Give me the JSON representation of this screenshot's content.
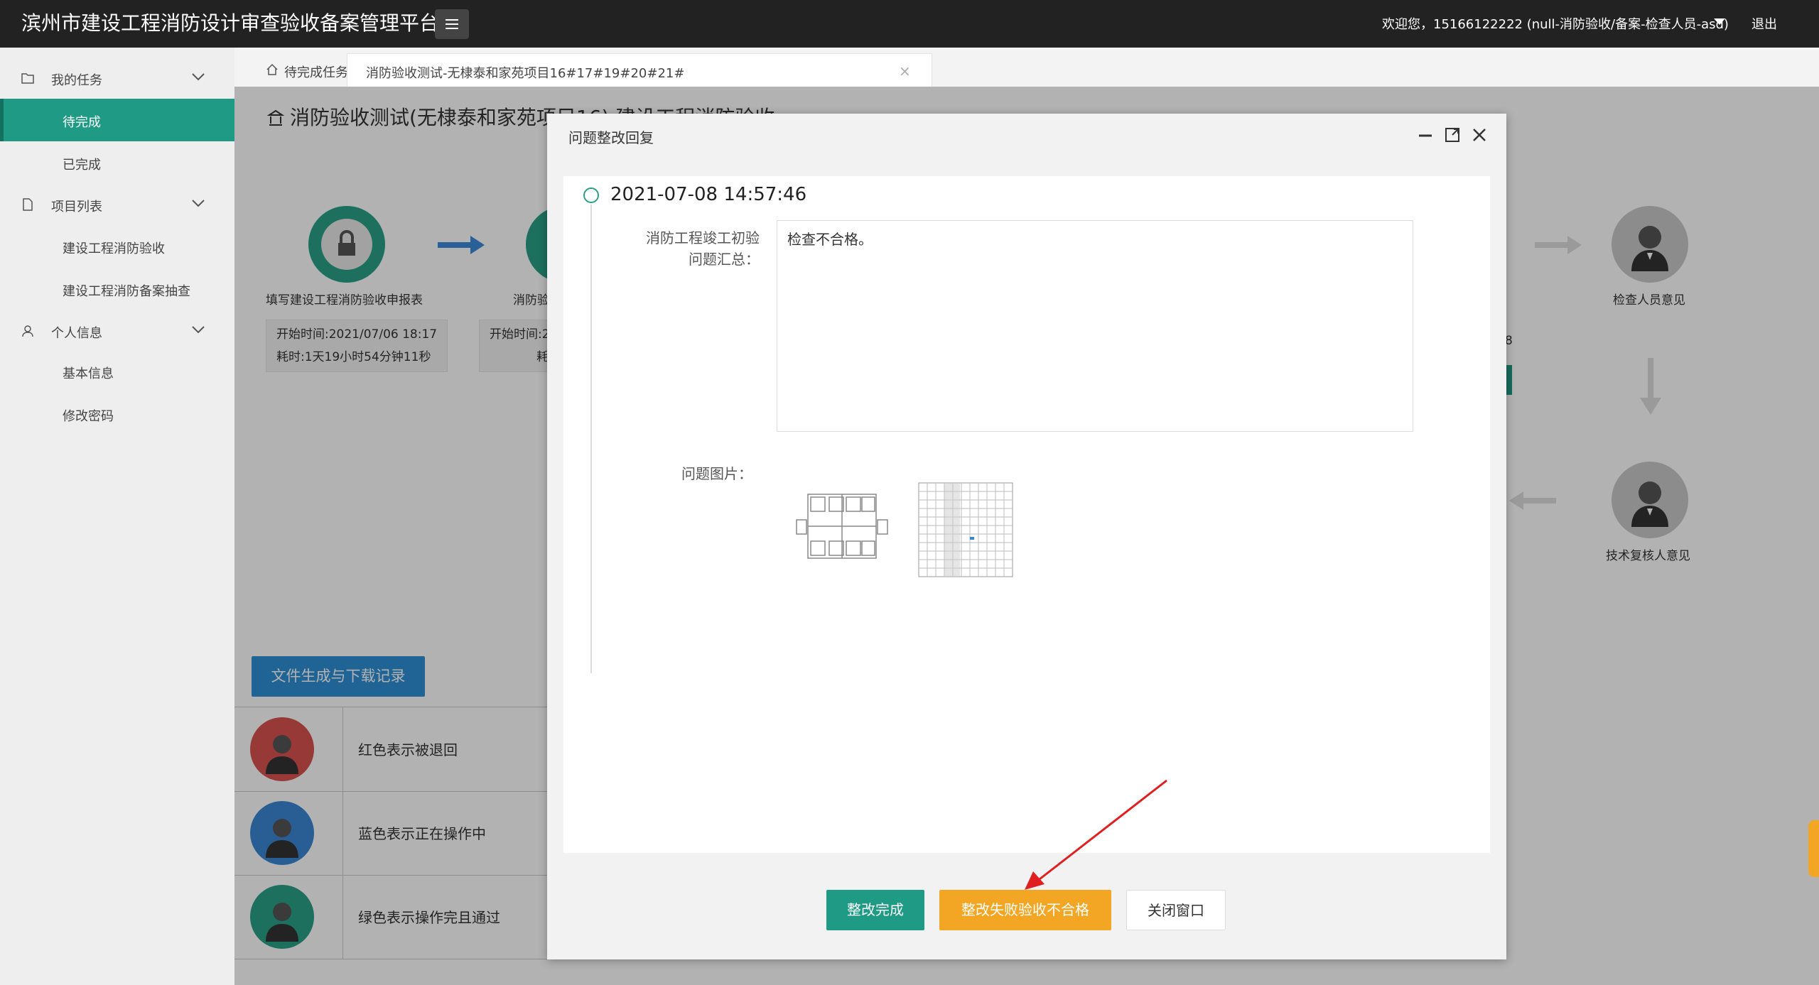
{
  "header": {
    "app_title": "滨州市建设工程消防设计审查验收备案管理平台",
    "welcome_text": "欢迎您，15166122222 (null-消防验收/备案-检查人员-asd)",
    "logout_label": "退出",
    "menu_icon": "hamburger-icon"
  },
  "sidebar": {
    "groups": [
      {
        "label": "我的任务",
        "icon": "folder-icon",
        "items": [
          {
            "label": "待完成",
            "active": true
          },
          {
            "label": "已完成",
            "active": false
          }
        ]
      },
      {
        "label": "项目列表",
        "icon": "file-icon",
        "items": [
          {
            "label": "建设工程消防验收"
          },
          {
            "label": "建设工程消防备案抽查"
          }
        ]
      },
      {
        "label": "个人信息",
        "icon": "user-icon",
        "items": [
          {
            "label": "基本信息"
          },
          {
            "label": "修改密码"
          }
        ]
      }
    ]
  },
  "tabs": {
    "home_label": "待完成任务",
    "current_label": "消防验收测试-无棣泰和家苑项目16#17#19#20#21#",
    "close_symbol": "×"
  },
  "page": {
    "heading": "消防验收测试(无棣泰和家苑项目16) 建设工程消防验收",
    "flow": {
      "node1_label": "填写建设工程消防验收申报表",
      "node1_start": "开始时间:2021/07/06 18:17",
      "node1_duration": "耗时:1天19小时54分钟11秒",
      "node2_label": "消防验",
      "node2_start": "开始时间:2",
      "node2_duration": "耗",
      "node_right1_label": "检查人员意见",
      "node_right2_label": "技术复核人意见",
      "partial_digit": "8"
    },
    "download_button": "文件生成与下载记录",
    "legend": [
      {
        "text": "红色表示被退回",
        "color": "#d9534f"
      },
      {
        "text": "蓝色表示正在操作中",
        "color": "#3b87d6"
      },
      {
        "text": "绿色表示操作完且通过",
        "color": "#2aa087"
      }
    ]
  },
  "modal": {
    "title": "问题整改回复",
    "timestamp": "2021-07-08 14:57:46",
    "summary_label_line1": "消防工程竣工初验",
    "summary_label_line2": "问题汇总：",
    "summary_value": "检查不合格。",
    "images_label": "问题图片：",
    "buttons": {
      "complete": "整改完成",
      "fail": "整改失败验收不合格",
      "close": "关闭窗口"
    }
  },
  "colors": {
    "topbar": "#222222",
    "accent_green": "#1f9a85",
    "orange": "#f2a623",
    "blue": "#2e8fd6"
  }
}
